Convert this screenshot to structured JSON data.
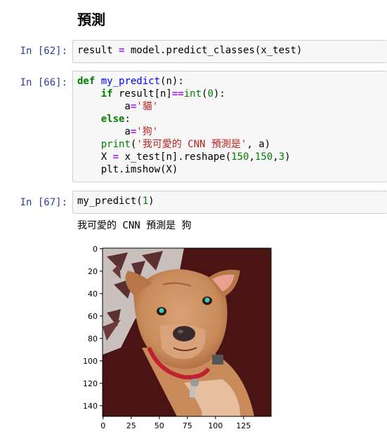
{
  "heading": "預測",
  "cells": [
    {
      "prompt": "In [62]:",
      "lines": [
        [
          [
            "",
            "result "
          ],
          [
            "op",
            "="
          ],
          [
            "",
            " model.predict_classes(x_test)"
          ]
        ]
      ]
    },
    {
      "prompt": "In [66]:",
      "lines": [
        [
          [
            "kw",
            "def"
          ],
          [
            "",
            " "
          ],
          [
            "fn",
            "my_predict"
          ],
          [
            "",
            "(n):"
          ]
        ],
        [
          [
            "",
            "    "
          ],
          [
            "kw",
            "if"
          ],
          [
            "",
            " result[n]"
          ],
          [
            "op",
            "=="
          ],
          [
            "bi",
            "int"
          ],
          [
            "",
            "("
          ],
          [
            "num",
            "0"
          ],
          [
            "",
            "):"
          ]
        ],
        [
          [
            "",
            "        a"
          ],
          [
            "op",
            "="
          ],
          [
            "str",
            "'貓'"
          ]
        ],
        [
          [
            "",
            "    "
          ],
          [
            "kw",
            "else"
          ],
          [
            "",
            ":"
          ]
        ],
        [
          [
            "",
            "        a"
          ],
          [
            "op",
            "="
          ],
          [
            "str",
            "'狗'"
          ]
        ],
        [
          [
            "",
            "    "
          ],
          [
            "bi",
            "print"
          ],
          [
            "",
            "("
          ],
          [
            "str",
            "'我可愛的 CNN 預測是'"
          ],
          [
            "",
            ", a)"
          ]
        ],
        [
          [
            "",
            "    X "
          ],
          [
            "op",
            "="
          ],
          [
            "",
            " x_test[n].reshape("
          ],
          [
            "num",
            "150"
          ],
          [
            "",
            ","
          ],
          [
            "num",
            "150"
          ],
          [
            "",
            ","
          ],
          [
            "num",
            "3"
          ],
          [
            "",
            ")"
          ]
        ],
        [
          [
            "",
            "    plt.imshow(X)"
          ]
        ]
      ]
    },
    {
      "prompt": "In [67]:",
      "lines": [
        [
          [
            "",
            "my_predict("
          ],
          [
            "num",
            "1"
          ],
          [
            "",
            ")"
          ]
        ]
      ]
    }
  ],
  "output_text": "我可愛的 CNN 預測是 狗",
  "plot": {
    "y_ticks": [
      "0",
      "20",
      "40",
      "60",
      "80",
      "100",
      "120",
      "140"
    ],
    "x_ticks": [
      "0",
      "25",
      "50",
      "75",
      "100",
      "125"
    ],
    "y_tick_values": [
      0,
      20,
      40,
      60,
      80,
      100,
      120,
      140
    ],
    "x_tick_values": [
      0,
      25,
      50,
      75,
      100,
      125
    ],
    "image_extent": [
      150,
      150
    ],
    "image_subject": "dog-photo"
  }
}
